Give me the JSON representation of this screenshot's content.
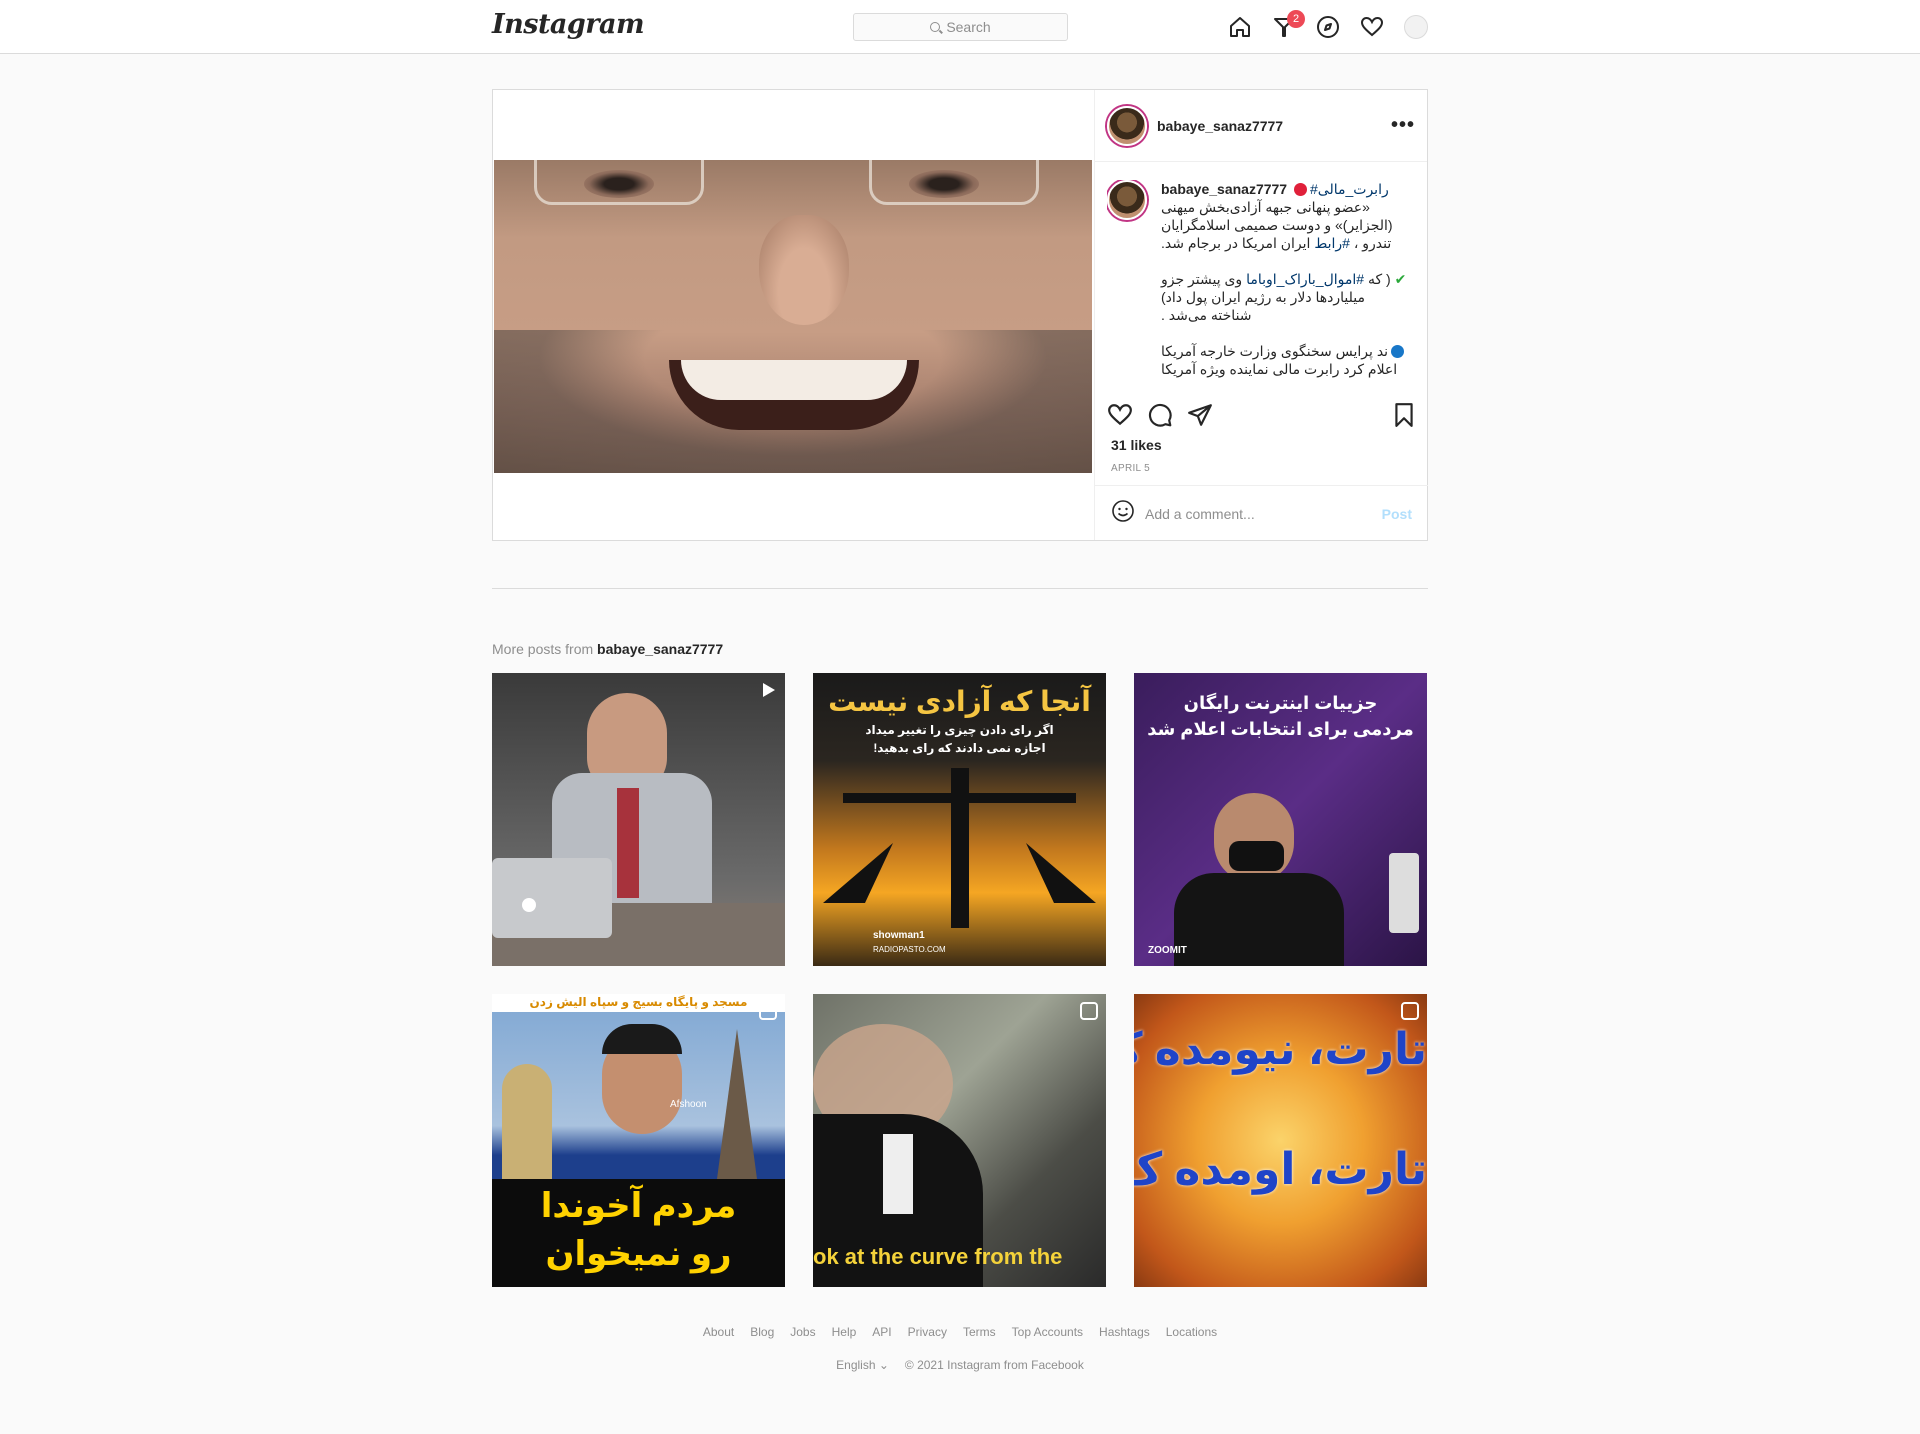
{
  "header": {
    "logo": "Instagram",
    "search_placeholder": "Search",
    "notification_count": "2"
  },
  "post": {
    "username": "babaye_sanaz7777",
    "caption": {
      "username": "babaye_sanaz7777",
      "line1_tag": "#رابرت_مالی",
      "line2": "«عضو پنهانی جبهه آزادی‌بخش میهنی",
      "line3": "(الجزایر)» و دوست صمیمی اسلامگرایان",
      "line4_pre": "تندرو ،",
      "line4_tag": "#رابط",
      "line4_post": "ایران امریکا در برجام شد.",
      "line5_pre": "وی پیشتر جزو",
      "line5_tag": "#اموال_باراک_اوباما",
      "line5_post": "( که",
      "line6": "میلیاردها دلار به رژیم ایران پول داد)",
      "line7": "شناخته می‌شد .",
      "line8": "ند پرایس سخنگوی وزارت خارجه آمریکا",
      "line9": "اعلام کرد رابرت مالی نماینده ویژه آمریکا"
    },
    "likes": "31 likes",
    "date": "APRIL 5",
    "comment_placeholder": "Add a comment...",
    "post_button": "Post"
  },
  "more_posts": {
    "prefix": "More posts from ",
    "username": "babaye_sanaz7777",
    "tiles": [
      {
        "type": "video"
      },
      {
        "title": "آنجا که آزادی نیست",
        "subtitle": "اگر رای دادن چیزی را تغییر میداد",
        "subtitle2": "اجازه نمی دادند که رای بدهید!",
        "credit": "showman1",
        "credit2": "RADIOPASTO.COM"
      },
      {
        "title": "جزییات اینترنت رایگان",
        "title2": "مردمی برای انتخابات اعلام شد",
        "brand": "ZOOMIT"
      },
      {
        "banner": "مسجد و پایگاه بسیج و سپاه الیش زدن",
        "caption1": "مردم آخوندا",
        "caption2": "رو نمیخوان",
        "watermark": "Afshoon"
      },
      {
        "subtitle": "ok at the curve from the"
      },
      {
        "line1": "تارت، نیومده ک",
        "line2": "تارت، اومده ک"
      }
    ]
  },
  "footer": {
    "links": [
      "About",
      "Blog",
      "Jobs",
      "Help",
      "API",
      "Privacy",
      "Terms",
      "Top Accounts",
      "Hashtags",
      "Locations"
    ],
    "language": "English",
    "copyright": "© 2021 Instagram from Facebook"
  }
}
